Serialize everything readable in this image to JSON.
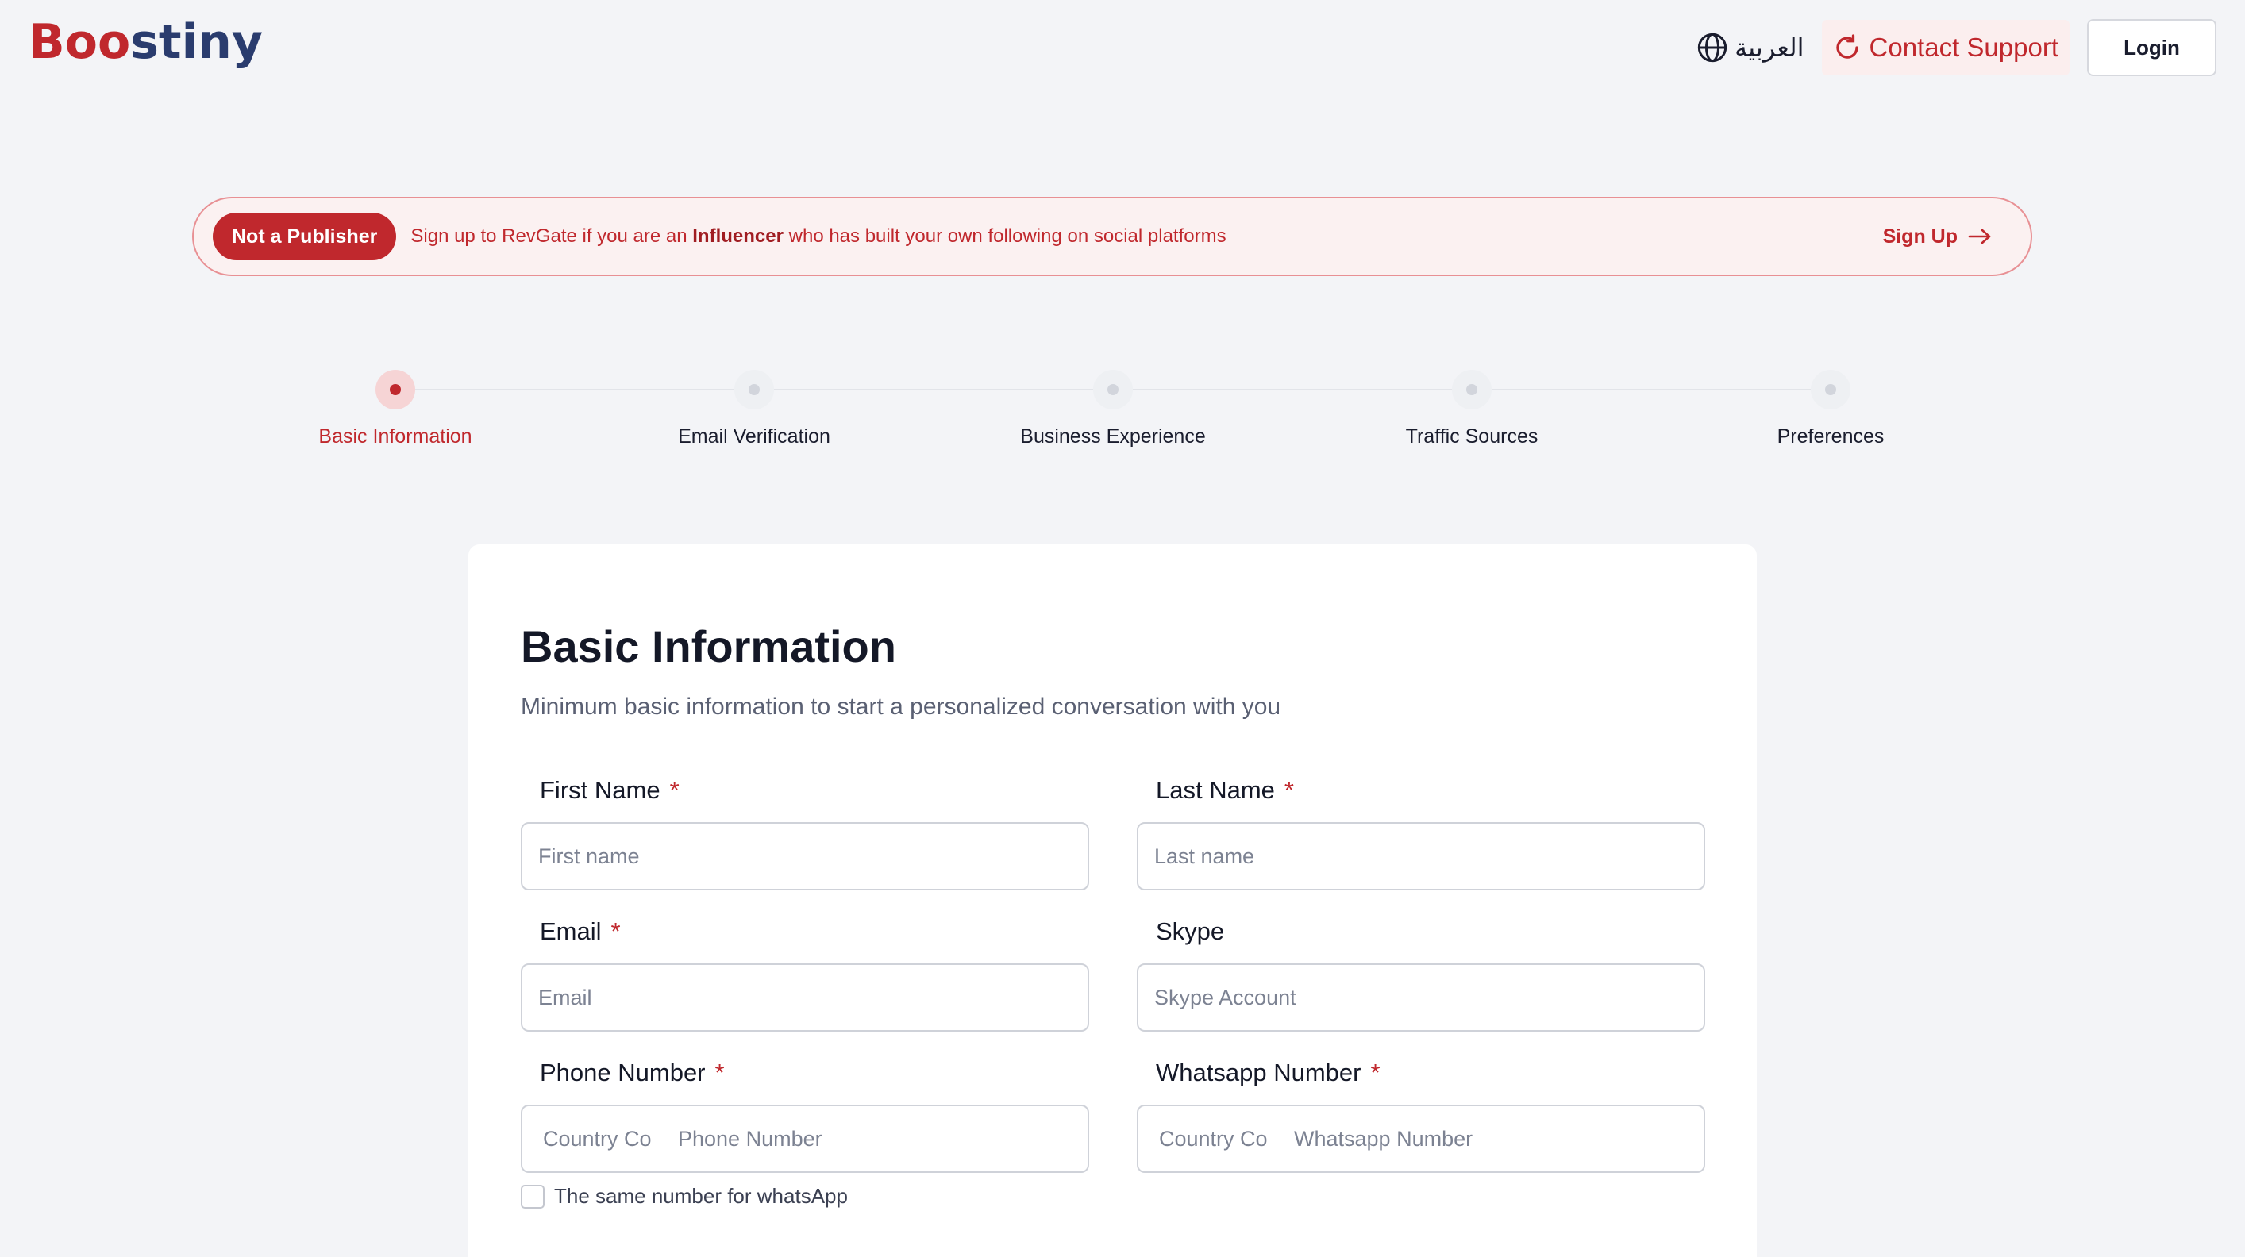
{
  "header": {
    "logo_text": "Boostiny",
    "language_label": "العربية",
    "support_label": "Contact Support",
    "login_label": "Login"
  },
  "banner": {
    "badge": "Not a Publisher",
    "text_prefix": "Sign up to RevGate if you are an ",
    "text_bold": "Influencer",
    "text_suffix": " who has built your own following on social platforms",
    "signup_label": "Sign Up"
  },
  "stepper": {
    "steps": [
      {
        "label": "Basic Information",
        "active": true
      },
      {
        "label": "Email Verification",
        "active": false
      },
      {
        "label": "Business Experience",
        "active": false
      },
      {
        "label": "Traffic Sources",
        "active": false
      },
      {
        "label": "Preferences",
        "active": false
      }
    ]
  },
  "form": {
    "title": "Basic Information",
    "subtitle": "Minimum basic information to start a personalized conversation with you",
    "required_mark": "*",
    "first_name": {
      "label": "First Name",
      "placeholder": "First name",
      "required": true
    },
    "last_name": {
      "label": "Last Name",
      "placeholder": "Last name",
      "required": true
    },
    "email": {
      "label": "Email",
      "placeholder": "Email",
      "required": true
    },
    "skype": {
      "label": "Skype",
      "placeholder": "Skype Account",
      "required": false
    },
    "phone": {
      "label": "Phone Number",
      "country_placeholder": "Country Co",
      "placeholder": "Phone Number",
      "required": true
    },
    "whatsapp": {
      "label": "Whatsapp Number",
      "country_placeholder": "Country Co",
      "placeholder": "Whatsapp Number",
      "required": true
    },
    "same_number_label": "The same number for whatsApp"
  },
  "colors": {
    "brand_red": "#c0282d",
    "brand_navy": "#2a3c6e",
    "background": "#f3f4f7"
  },
  "icons": [
    "globe-icon",
    "support-refresh-icon",
    "arrow-right-icon"
  ]
}
